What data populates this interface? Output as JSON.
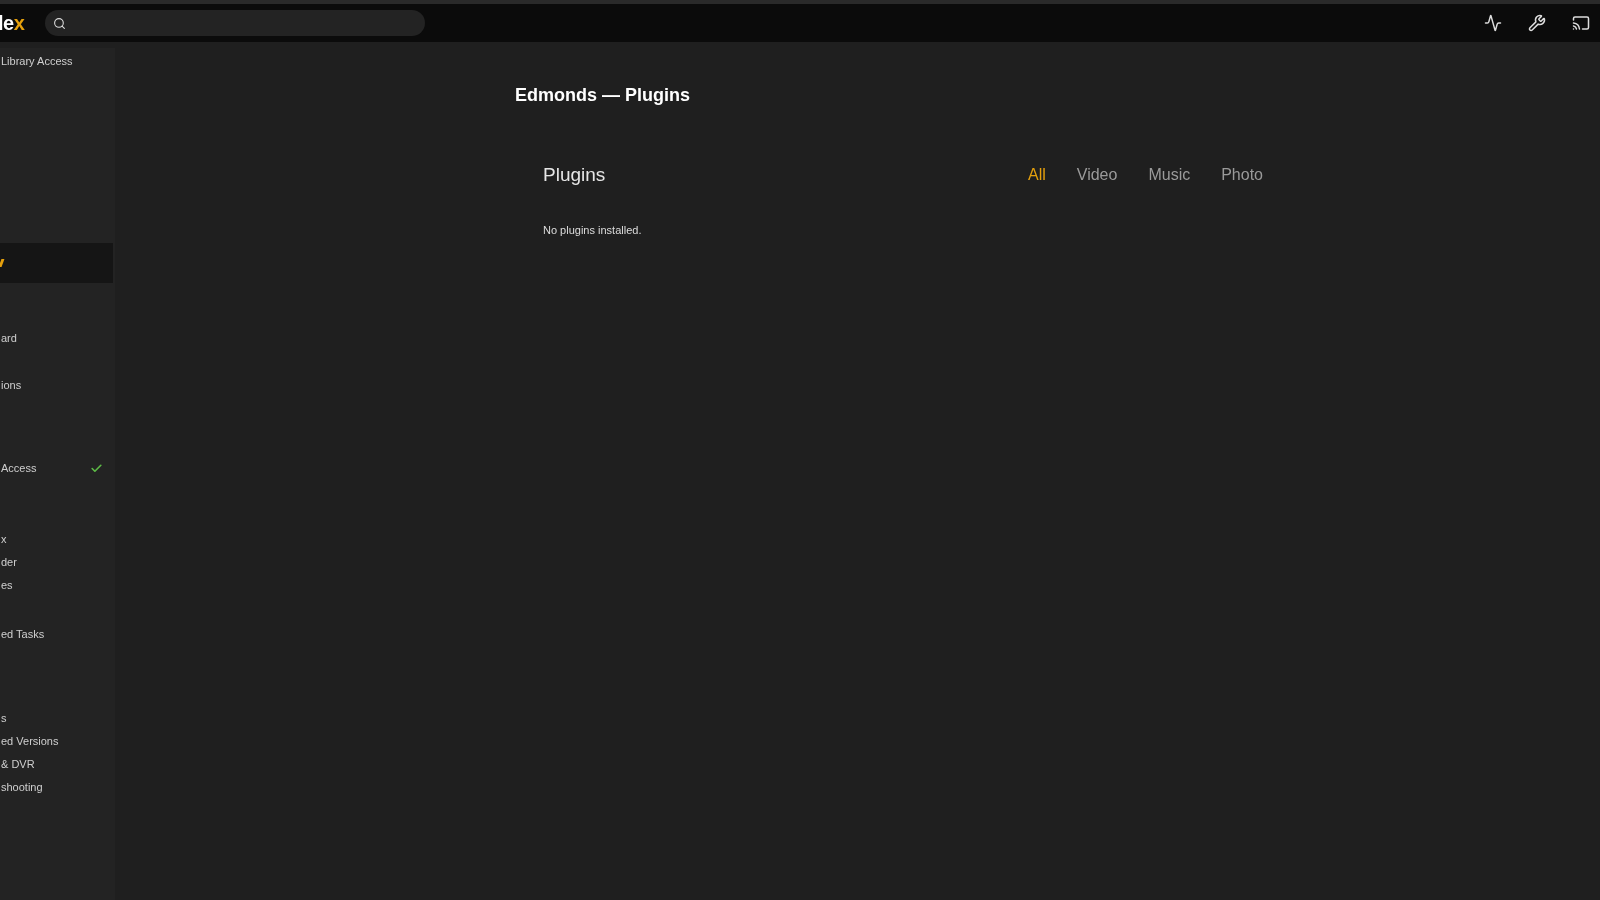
{
  "top_bar": {
    "logo": {
      "text": "le",
      "accent": "x"
    }
  },
  "sidebar": {
    "items": [
      {
        "kind": "item",
        "label": "Library Access",
        "selected": false,
        "checked": false
      },
      {
        "kind": "item",
        "selected": true,
        "checked": false
      },
      {
        "kind": "item",
        "label": "ard",
        "selected": false,
        "checked": false
      },
      {
        "kind": "item",
        "label": "ions",
        "selected": false,
        "checked": false
      },
      {
        "kind": "item",
        "label": "Access",
        "selected": false,
        "checked": true
      },
      {
        "kind": "item",
        "label": "x",
        "selected": false,
        "checked": false
      },
      {
        "kind": "item",
        "label": "der",
        "selected": false,
        "checked": false
      },
      {
        "kind": "item",
        "label": "es",
        "selected": false,
        "checked": false
      },
      {
        "kind": "item",
        "label": "ed Tasks",
        "selected": false,
        "checked": false
      },
      {
        "kind": "item",
        "label": "s",
        "selected": false,
        "checked": false
      },
      {
        "kind": "item",
        "label": "ed Versions",
        "selected": false,
        "checked": false
      },
      {
        "kind": "item",
        "label": "& DVR",
        "selected": false,
        "checked": false
      },
      {
        "kind": "item",
        "label": "shooting",
        "selected": false,
        "checked": false
      }
    ]
  },
  "page": {
    "title": "Edmonds — Plugins",
    "heading": "Plugins",
    "tabs": [
      {
        "label": "All",
        "selected": true
      },
      {
        "label": "Video",
        "selected": false
      },
      {
        "label": "Music",
        "selected": false
      },
      {
        "label": "Photo",
        "selected": false
      }
    ],
    "empty_message": "No plugins installed."
  }
}
